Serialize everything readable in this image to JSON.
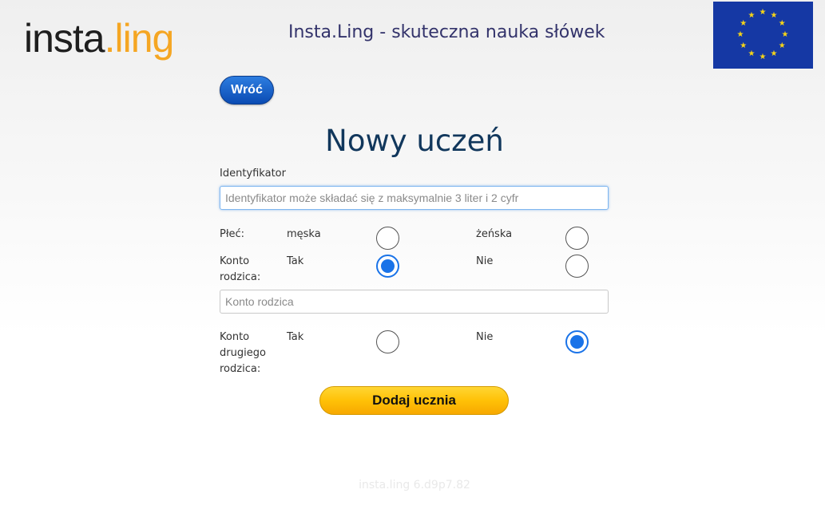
{
  "header": {
    "logo_part1": "insta",
    "logo_dot": ".",
    "logo_part2": "ling",
    "title": "Insta.Ling - skuteczna nauka słówek"
  },
  "back_button": "Wróć",
  "page_title": "Nowy uczeń",
  "identifier": {
    "label": "Identyfikator",
    "placeholder": "Identyfikator może składać się z maksymalnie 3 liter i 2 cyfr",
    "value": ""
  },
  "gender": {
    "label": "Płeć:",
    "option_male": "męska",
    "option_female": "żeńska",
    "selected": null
  },
  "parent_account": {
    "label_line1": "Konto",
    "label_line2": "rodzica:",
    "option_yes": "Tak",
    "option_no": "Nie",
    "selected": "Tak",
    "input_placeholder": "Konto rodzica",
    "input_value": ""
  },
  "second_parent_account": {
    "label_line1": "Konto",
    "label_line2": "drugiego",
    "label_line3": "rodzica:",
    "option_yes": "Tak",
    "option_no": "Nie",
    "selected": "Nie"
  },
  "submit_button": "Dodaj ucznia",
  "version": "insta.ling 6.d9p7.82",
  "colors": {
    "accent_blue": "#1a73e8",
    "title_color": "#11375c",
    "submit_yellow": "#ffc107",
    "flag_blue": "#1538a4",
    "flag_star": "#f6d417"
  },
  "icons": {
    "flag": "eu-flag-icon",
    "star": "star-icon"
  }
}
